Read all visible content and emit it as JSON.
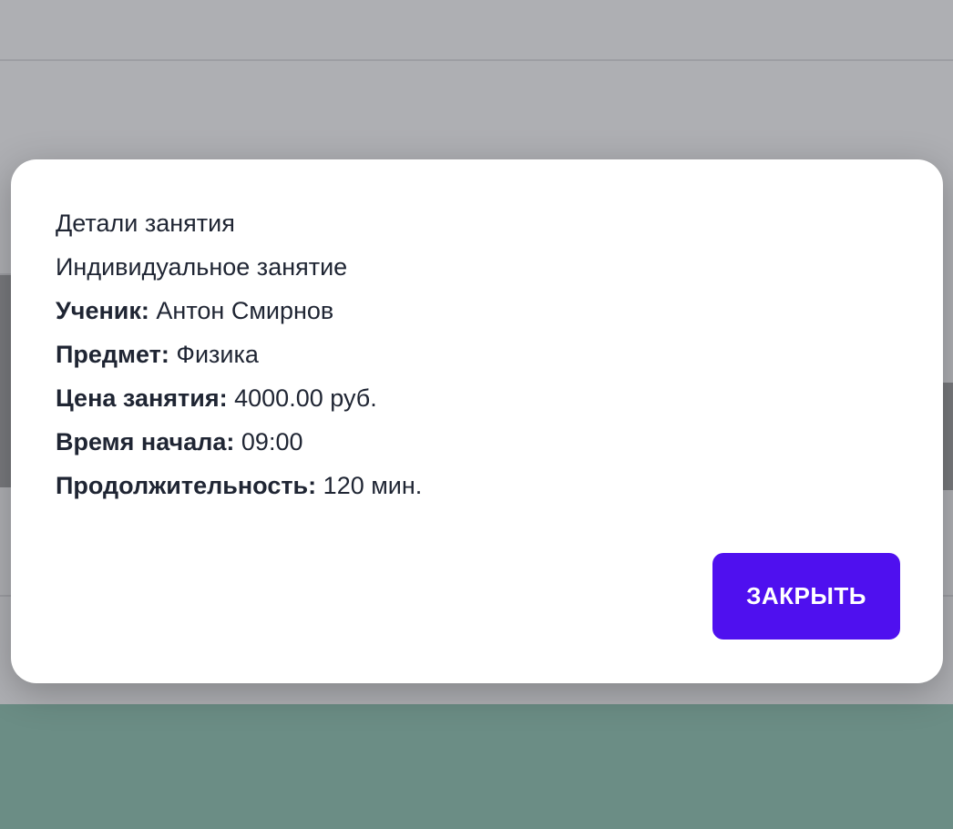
{
  "modal": {
    "title": "Детали занятия",
    "lesson_type": "Индивидуальное занятие",
    "fields": [
      {
        "label": "Ученик:",
        "value": "Антон Смирнов"
      },
      {
        "label": "Предмет:",
        "value": "Физика"
      },
      {
        "label": "Цена занятия:",
        "value": "4000.00 руб."
      },
      {
        "label": "Время начала:",
        "value": "09:00"
      },
      {
        "label": "Продолжительность:",
        "value": "120 мин."
      }
    ],
    "close_label": "ЗАКРЫТЬ"
  },
  "colors": {
    "accent": "#4f10ef",
    "overlay": "#aeafb3",
    "text": "#1f2533"
  }
}
